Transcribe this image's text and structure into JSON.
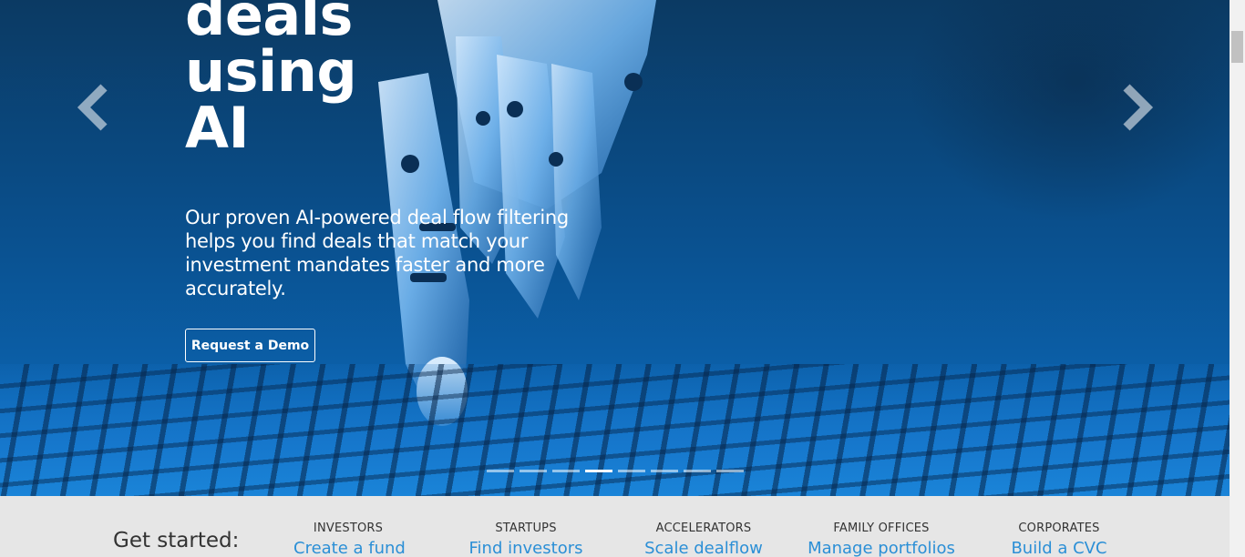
{
  "hero": {
    "headline_lines": [
      "deals",
      "using",
      "AI"
    ],
    "subtext": "Our proven AI-powered deal flow filtering helps you find deals that match your investment mandates faster and more accurately.",
    "cta_label": "Request a Demo",
    "prev_icon": "chevron-left-icon",
    "next_icon": "chevron-right-icon",
    "slides_total": 8,
    "active_slide": 4
  },
  "get_started": {
    "label": "Get started:",
    "audiences": [
      {
        "category": "INVESTORS",
        "link": "Create a fund"
      },
      {
        "category": "STARTUPS",
        "link": "Find investors"
      },
      {
        "category": "ACCELERATORS",
        "link": "Scale dealflow"
      },
      {
        "category": "FAMILY OFFICES",
        "link": "Manage portfolios"
      },
      {
        "category": "CORPORATES",
        "link": "Build a CVC"
      }
    ]
  },
  "colors": {
    "hero_blue": "#0a4f8c",
    "link_blue": "#2b8fd6",
    "band_bg": "#e6e6e6"
  }
}
